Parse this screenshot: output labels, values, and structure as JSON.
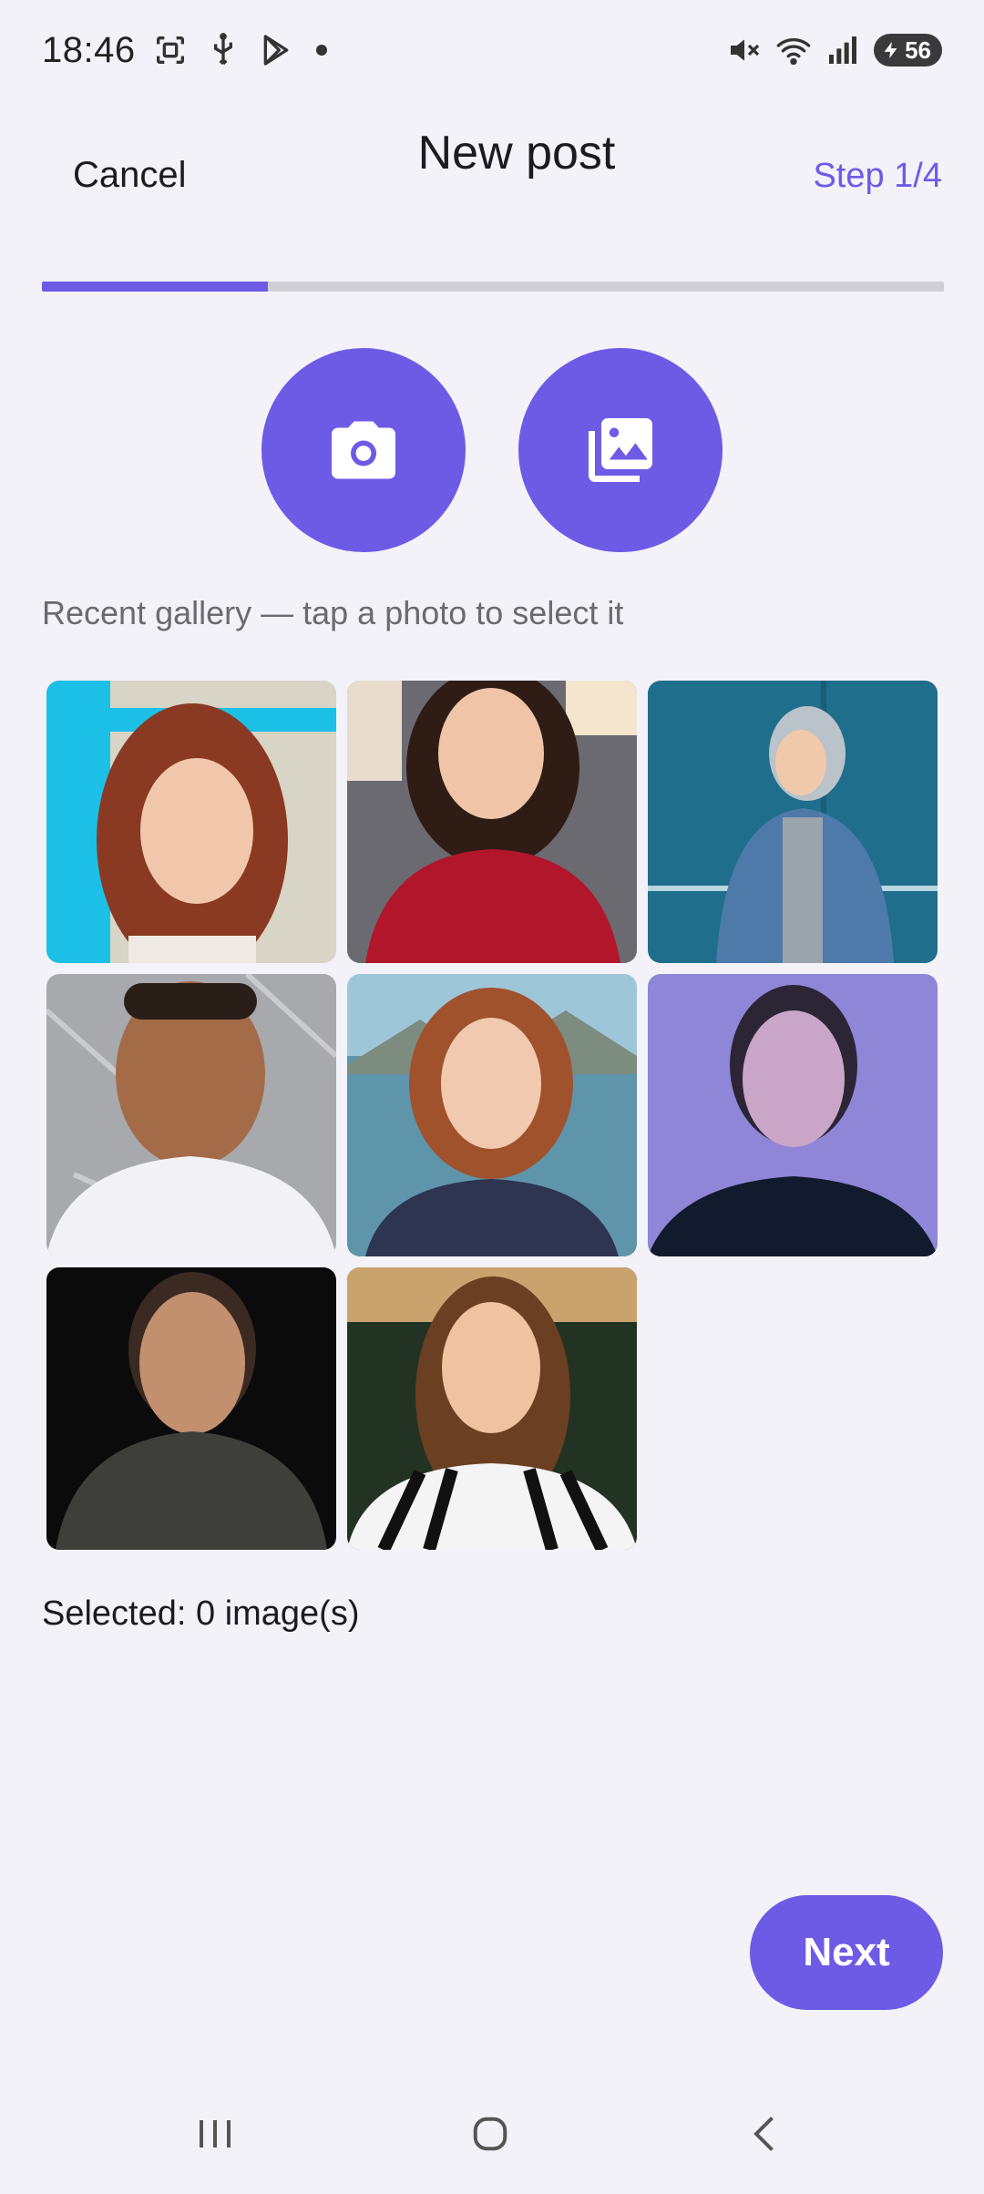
{
  "status_bar": {
    "time": "18:46",
    "battery_level": "56"
  },
  "header": {
    "cancel_label": "Cancel",
    "title": "New post",
    "step_label": "Step 1/4"
  },
  "progress": {
    "fraction": 0.25,
    "accent_color": "#6d5be6"
  },
  "actions": {
    "camera_icon": "camera-icon",
    "gallery_icon": "photo-library-icon"
  },
  "gallery": {
    "hint": "Recent gallery — tap a photo to select it",
    "photos": [
      {
        "name": "photo-1",
        "subject": "woman auburn hair, cyan background"
      },
      {
        "name": "photo-2",
        "subject": "smiling woman, red sweater"
      },
      {
        "name": "photo-3",
        "subject": "person in denim jacket, teal wall"
      },
      {
        "name": "photo-4",
        "subject": "smiling man, white t-shirt"
      },
      {
        "name": "photo-5",
        "subject": "woman with bob haircut, lake"
      },
      {
        "name": "photo-6",
        "subject": "woman, purple lighting"
      },
      {
        "name": "photo-7",
        "subject": "man, dark sweater"
      },
      {
        "name": "photo-8",
        "subject": "woman, striped shirt"
      }
    ]
  },
  "selection": {
    "label": "Selected: 0 image(s)"
  },
  "footer": {
    "next_label": "Next"
  },
  "colors": {
    "accent": "#6d5be6",
    "background": "#f3f2f8",
    "hint_text": "#6b6a72"
  }
}
